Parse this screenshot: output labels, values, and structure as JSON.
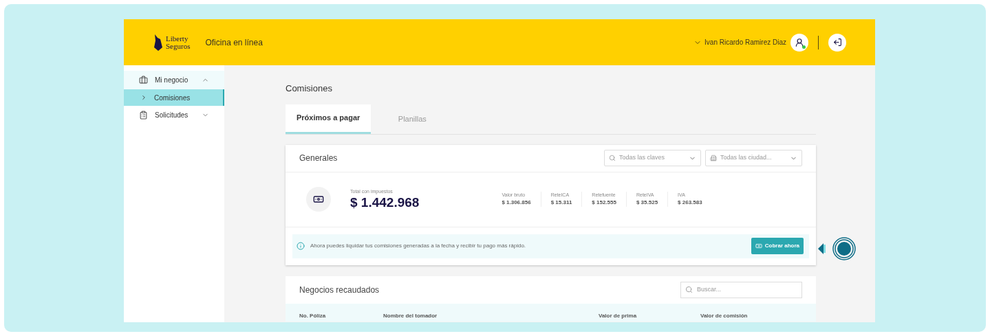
{
  "header": {
    "logo_text": [
      "Liberty",
      "Seguros"
    ],
    "app_name": "Oficina en línea",
    "user_name": "Ivan Ricardo Ramirez Diaz",
    "user_online": true
  },
  "sidebar": {
    "items": [
      {
        "label": "Mi negocio",
        "kind": "briefcase",
        "expanded": true,
        "children": [
          {
            "label": "Comisiones",
            "selected": true
          }
        ]
      },
      {
        "label": "Solicitudes",
        "kind": "clipboard",
        "expanded": false
      }
    ]
  },
  "page_title": "Comisiones",
  "tabs": [
    {
      "label": "Próximos a pagar",
      "selected": true
    },
    {
      "label": "Planillas",
      "selected": false
    }
  ],
  "generales": {
    "title": "Generales",
    "filters": [
      {
        "kind": "search",
        "placeholder": "Todas las claves"
      },
      {
        "kind": "building",
        "placeholder": "Todas las ciudad..."
      }
    ],
    "total_label": "Total con impuestos",
    "total": "$ 1.442.968",
    "breakdown": [
      {
        "label": "Valor bruto",
        "value": "$ 1.306.856"
      },
      {
        "label": "ReteICA",
        "value": "$ 15.311"
      },
      {
        "label": "Retefuente",
        "value": "$ 152.555"
      },
      {
        "label": "ReteIVA",
        "value": "$ 35.525"
      },
      {
        "label": "IVA",
        "value": "$ 263.583"
      }
    ],
    "notice": "Ahora puedes liquidar tus comisiones generadas a la fecha y recibir tu pago más rápido.",
    "action": "Cobrar ahora"
  },
  "negocios": {
    "title": "Negocios recaudados",
    "search_placeholder": "Buscar...",
    "columns": [
      "No. Póliza",
      "Nombre del tomador",
      "Valor de prima",
      "Valor de comisión"
    ]
  }
}
